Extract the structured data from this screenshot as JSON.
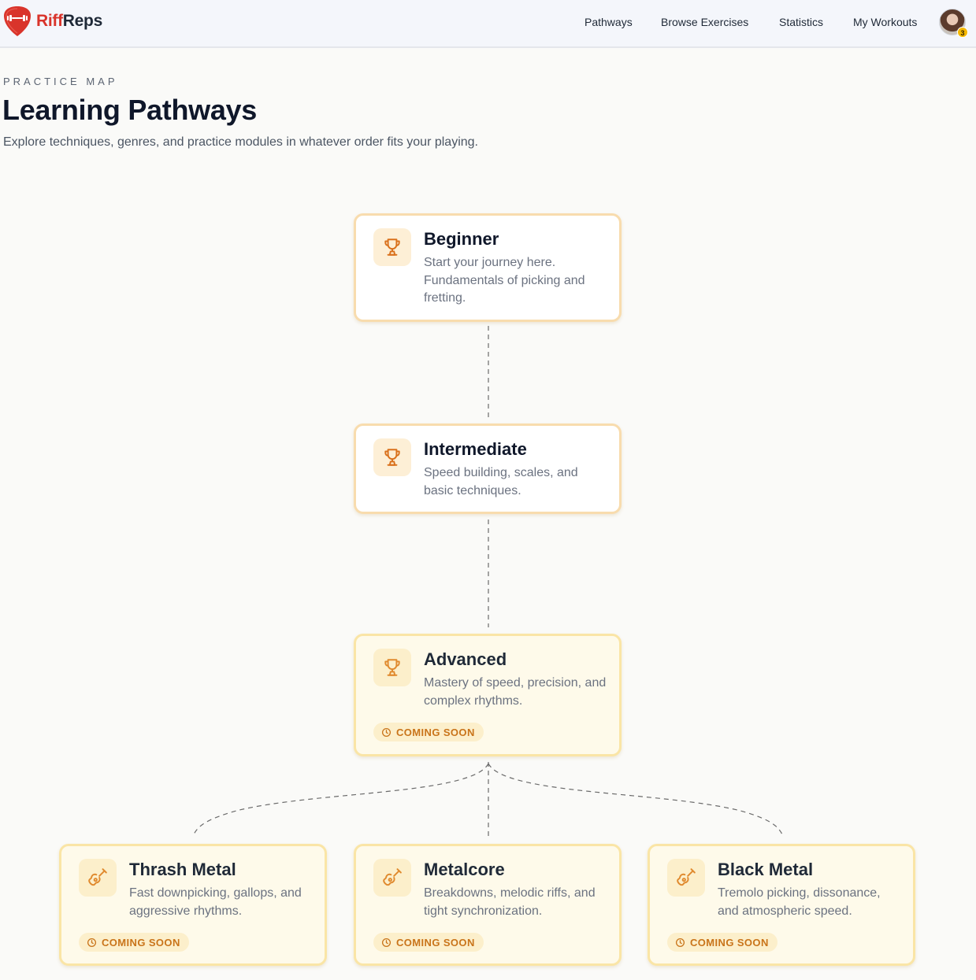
{
  "brand": {
    "name_part1": "Riff",
    "name_part2": "Reps"
  },
  "nav": {
    "items": [
      "Pathways",
      "Browse Exercises",
      "Statistics",
      "My Workouts"
    ],
    "notification_count": "3"
  },
  "header": {
    "eyebrow": "PRACTICE MAP",
    "title": "Learning Pathways",
    "subtitle": "Explore techniques, genres, and practice modules in whatever order fits your playing."
  },
  "pathways": [
    {
      "title": "Beginner",
      "description": "Start your journey here. Fundamentals of picking and fretting.",
      "icon": "trophy-icon",
      "status": ""
    },
    {
      "title": "Intermediate",
      "description": "Speed building, scales, and basic techniques.",
      "icon": "trophy-icon",
      "status": ""
    },
    {
      "title": "Advanced",
      "description": "Mastery of speed, precision, and complex rhythms.",
      "icon": "trophy-icon",
      "status": "COMING SOON"
    },
    {
      "title": "Thrash Metal",
      "description": "Fast downpicking, gallops, and aggressive rhythms.",
      "icon": "guitar-icon",
      "status": "COMING SOON"
    },
    {
      "title": "Metalcore",
      "description": "Breakdowns, melodic riffs, and tight synchronization.",
      "icon": "guitar-icon",
      "status": "COMING SOON"
    },
    {
      "title": "Black Metal",
      "description": "Tremolo picking, dissonance, and atmospheric speed.",
      "icon": "guitar-icon",
      "status": "COMING SOON"
    }
  ],
  "colors": {
    "brand_red": "#d9342b",
    "accent_orange": "#c9741a",
    "card_border": "#f8dcae",
    "soon_background": "#fefaea"
  }
}
